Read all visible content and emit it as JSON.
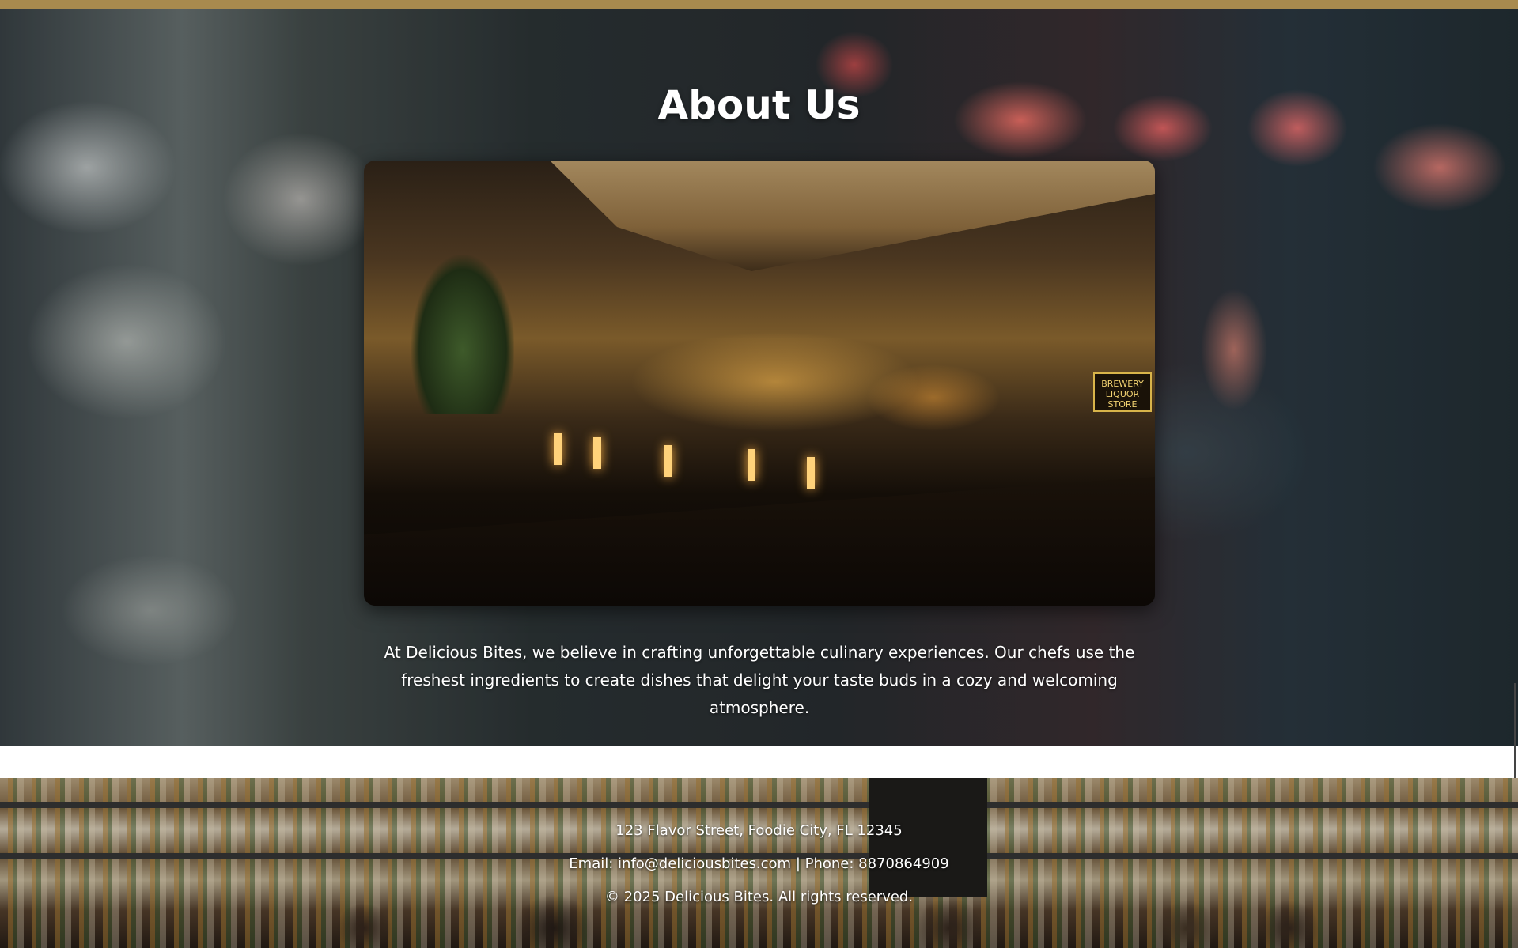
{
  "about": {
    "title": "About Us",
    "image_alt": "Restaurant bar interior",
    "image_sign_text": "BREWERY LIQUOR STORE",
    "description": "At Delicious Bites, we believe in crafting unforgettable culinary experiences. Our chefs use the freshest ingredients to create dishes that delight your taste buds in a cozy and welcoming atmosphere."
  },
  "footer": {
    "address": "123 Flavor Street, Foodie City, FL 12345",
    "email_prefix": "Email: ",
    "email": "info@deliciousbites.com",
    "separator": " | ",
    "phone_prefix": "Phone: ",
    "phone": "8870864909",
    "copyright": "© 2025 Delicious Bites. All rights reserved."
  },
  "colors": {
    "accent_bar": "#a88a4e",
    "text": "#ffffff"
  }
}
